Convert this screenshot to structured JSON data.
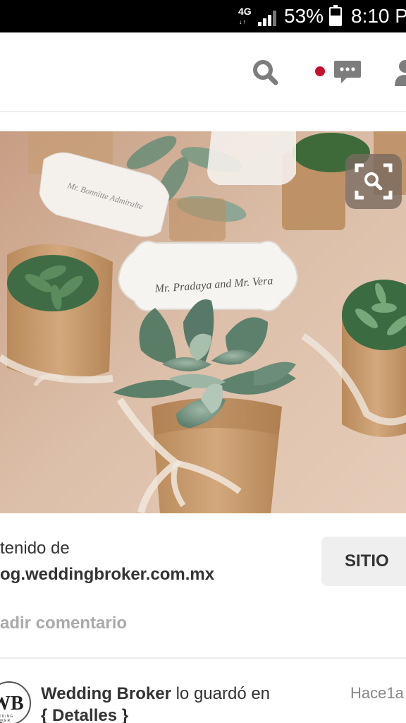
{
  "status_bar": {
    "network": "4G",
    "battery_percent": "53%",
    "time": "8:10 P"
  },
  "header": {
    "search_icon": "search-icon",
    "notification_color": "#c8102e",
    "messages_icon": "speech-bubble-icon",
    "profile_icon": "person-icon"
  },
  "pin": {
    "image_description_icon": "photo",
    "place_card_1": "Mr. Pradaya and Mr. Vera",
    "zoom_icon": "zoom-lens-icon"
  },
  "source": {
    "label": "tenido de",
    "domain": "og.weddingbroker.com.mx",
    "visit_button": "SITIO"
  },
  "comment": {
    "placeholder": "adir comentario"
  },
  "saved_by": {
    "avatar_monogram": "WB",
    "avatar_subtext": "WEDDING BROKER",
    "saver": "Wedding Broker",
    "action_text": " lo guardó en",
    "board": "{ Detalles }",
    "time": "Hace1a"
  },
  "colors": {
    "accent": "#c8102e",
    "button_bg": "#efefef",
    "muted_text": "#aaaaaa"
  }
}
